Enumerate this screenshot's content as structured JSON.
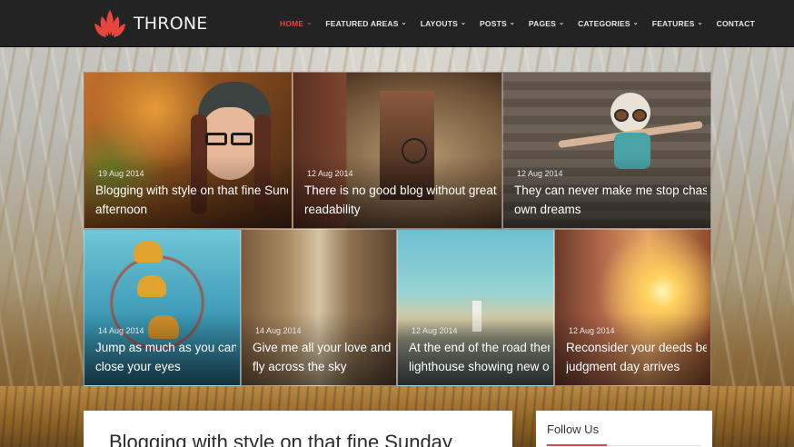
{
  "brand": {
    "name": "THRONE",
    "accent_color": "#e6463c"
  },
  "nav": [
    {
      "label": "HOME",
      "dropdown": true,
      "active": true
    },
    {
      "label": "FEATURED AREAS",
      "dropdown": true
    },
    {
      "label": "LAYOUTS",
      "dropdown": true
    },
    {
      "label": "POSTS",
      "dropdown": true
    },
    {
      "label": "PAGES",
      "dropdown": true
    },
    {
      "label": "CATEGORIES",
      "dropdown": true
    },
    {
      "label": "FEATURES",
      "dropdown": true
    },
    {
      "label": "CONTACT",
      "dropdown": false
    }
  ],
  "featured": [
    {
      "date": "19 Aug 2014",
      "title_line1": "Blogging with style on that fine Sunday",
      "title_line2": "afternoon"
    },
    {
      "date": "12 Aug 2014",
      "title_line1": "There is no good blog without great",
      "title_line2": "readability"
    },
    {
      "date": "12 Aug 2014",
      "title_line1": "They can never make me stop chasing my",
      "title_line2": "own dreams"
    },
    {
      "date": "14 Aug 2014",
      "title_line1": "Jump as much as you can and",
      "title_line2": "close your eyes"
    },
    {
      "date": "14 Aug 2014",
      "title_line1": "Give me all your love and I will",
      "title_line2": "fly across the sky"
    },
    {
      "date": "12 Aug 2014",
      "title_line1": "At the end of the road there is",
      "title_line2": "lighthouse showing new one"
    },
    {
      "date": "12 Aug 2014",
      "title_line1": "Reconsider your deeds before",
      "title_line2": "judgment day arrives"
    }
  ],
  "post": {
    "title": "Blogging with style on that fine Sunday"
  },
  "sidebar": {
    "widget_title": "Follow Us"
  }
}
